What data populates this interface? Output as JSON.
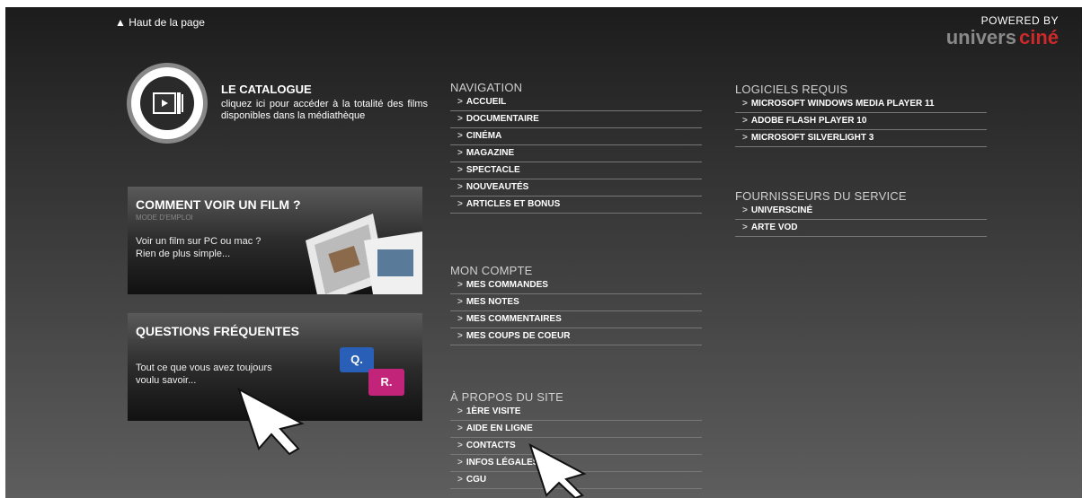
{
  "top": {
    "back_to_top": "▲ Haut de la page"
  },
  "powered": {
    "label": "POWERED BY",
    "brand_main": "univers",
    "brand_accent": "ciné"
  },
  "catalogue": {
    "title": "LE CATALOGUE",
    "description": "cliquez ici pour accéder à la totalité des films disponibles dans la médiathèque"
  },
  "how_to": {
    "title": "COMMENT VOIR UN FILM ?",
    "subtitle": "MODE D'EMPLOI",
    "text_line1": "Voir un film sur PC ou mac ?",
    "text_line2": "Rien de plus simple..."
  },
  "faq": {
    "title": "QUESTIONS FRÉQUENTES",
    "text_line1": "Tout ce que vous avez toujours",
    "text_line2": "voulu savoir...",
    "q": "Q.",
    "r": "R."
  },
  "navigation": {
    "heading": "NAVIGATION",
    "items": [
      "ACCUEIL",
      "DOCUMENTAIRE",
      "CINÉMA",
      "MAGAZINE",
      "SPECTACLE",
      "NOUVEAUTÉS",
      "ARTICLES ET BONUS"
    ]
  },
  "account": {
    "heading": "MON COMPTE",
    "items": [
      "MES COMMANDES",
      "MES NOTES",
      "MES COMMENTAIRES",
      "MES COUPS DE COEUR"
    ]
  },
  "about": {
    "heading": "À PROPOS DU SITE",
    "items": [
      "1ÈRE VISITE",
      "AIDE EN LIGNE",
      "CONTACTS",
      "INFOS LÉGALES",
      "CGU"
    ]
  },
  "software": {
    "heading": "LOGICIELS REQUIS",
    "items": [
      "MICROSOFT WINDOWS MEDIA PLAYER 11",
      "ADOBE FLASH PLAYER 10",
      "MICROSOFT SILVERLIGHT 3"
    ]
  },
  "providers": {
    "heading": "FOURNISSEURS DU SERVICE",
    "items": [
      "UNIVERSCINÉ",
      "ARTE VOD"
    ]
  },
  "chevron": ">",
  "colors": {
    "accent_red": "#cc2a2a",
    "q_blue": "#2a5fb8",
    "r_magenta": "#c2247a"
  }
}
